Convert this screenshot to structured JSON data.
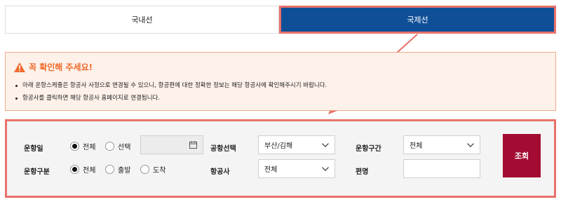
{
  "tabs": [
    {
      "label": "국내선",
      "active": false
    },
    {
      "label": "국제선",
      "active": true
    }
  ],
  "notice": {
    "title": "꼭 확인해 주세요!",
    "icon": "warning-icon",
    "items": [
      "아래 운항스케줄은 항공사 사정으로 변경될 수 있으니, 항공편에 대한 정확한 정보는 해당 항공사에 확인해주시기 바랍니다.",
      "항공사를 클릭하면 해당 항공사 홈페이지로 연결됩니다."
    ]
  },
  "search": {
    "operation_date": {
      "label": "운항일",
      "options": [
        {
          "label": "전체",
          "selected": true
        },
        {
          "label": "선택",
          "selected": false
        }
      ],
      "date_value": ""
    },
    "operation_type": {
      "label": "운항구분",
      "options": [
        {
          "label": "전체",
          "selected": true
        },
        {
          "label": "출발",
          "selected": false
        },
        {
          "label": "도착",
          "selected": false
        }
      ]
    },
    "airport": {
      "label": "공항선택",
      "value": "부산/김해"
    },
    "airline": {
      "label": "항공사",
      "value": "전체"
    },
    "route": {
      "label": "운항구간",
      "value": "전체"
    },
    "flight_no": {
      "label": "편명",
      "value": ""
    },
    "submit_label": "조회"
  },
  "colors": {
    "active_tab": "#0e4f98",
    "highlight": "#e9716b",
    "notice_title": "#ef6a2c",
    "search_button": "#a30b32"
  }
}
